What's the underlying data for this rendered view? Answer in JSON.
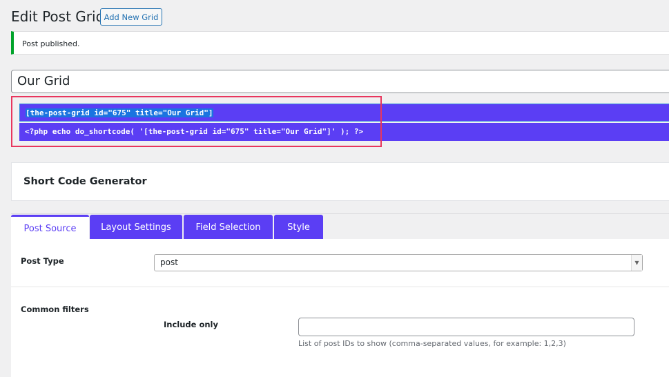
{
  "header": {
    "title": "Edit Post Grid",
    "add_new_label": "Add New Grid"
  },
  "notice": {
    "text": "Post published.",
    "color": "#00a32a"
  },
  "grid_title": {
    "value": "Our Grid"
  },
  "shortcodes": {
    "shortcode": "[the-post-grid id=\"675\" title=\"Our Grid\"]",
    "php": "<?php echo do_shortcode( '[the-post-grid id=\"675\" title=\"Our Grid\"]' ); ?>"
  },
  "generator": {
    "title": "Short Code Generator"
  },
  "tabs": [
    {
      "label": "Post Source",
      "active": true
    },
    {
      "label": "Layout Settings"
    },
    {
      "label": "Field Selection"
    },
    {
      "label": "Style"
    }
  ],
  "form": {
    "post_type_label": "Post Type",
    "post_type_value": "post",
    "common_filters_label": "Common filters",
    "include_only_label": "Include only",
    "include_only_value": "",
    "include_only_help": "List of post IDs to show (comma-separated values, for example: 1,2,3)"
  },
  "colors": {
    "accent": "#5b3ef4",
    "highlight": "#e8365d"
  }
}
